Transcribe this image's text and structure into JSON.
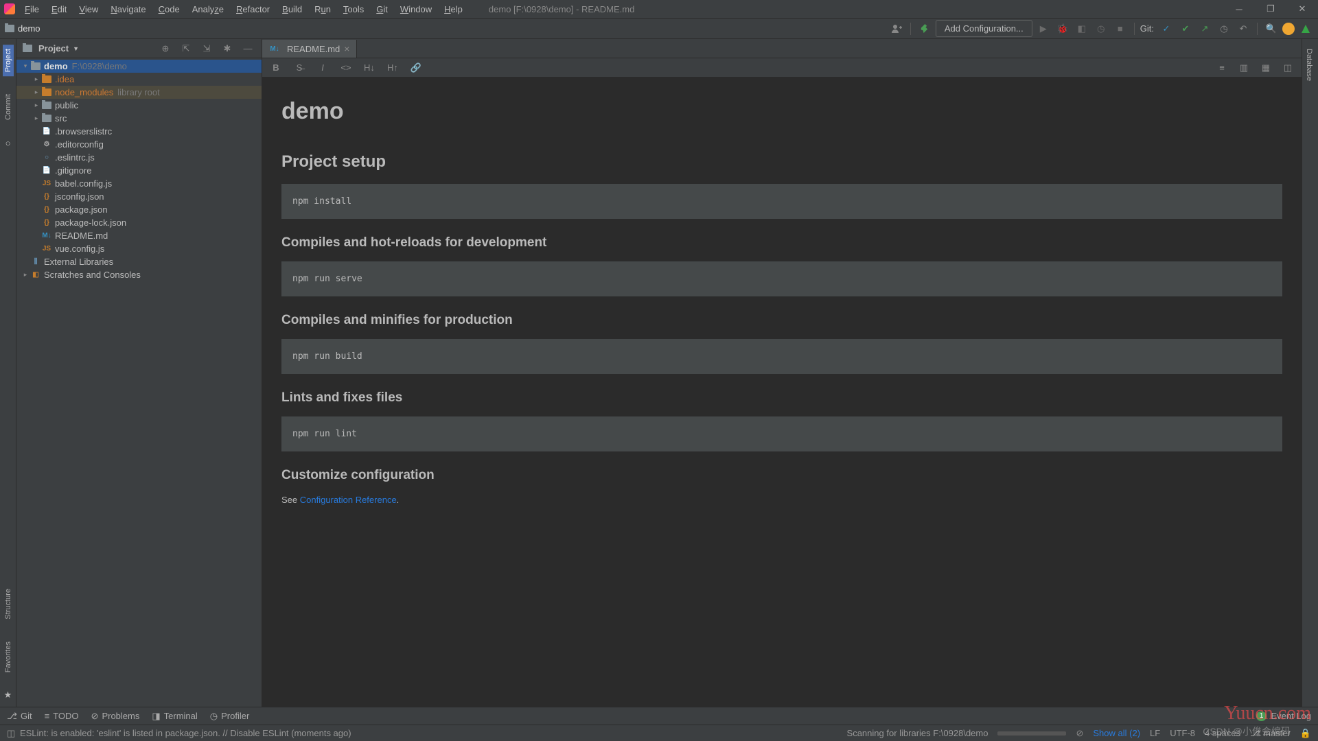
{
  "window": {
    "title": "demo [F:\\0928\\demo] - README.md"
  },
  "menu": [
    "File",
    "Edit",
    "View",
    "Navigate",
    "Code",
    "Analyze",
    "Refactor",
    "Build",
    "Run",
    "Tools",
    "Git",
    "Window",
    "Help"
  ],
  "breadcrumb": {
    "project": "demo"
  },
  "toolbar": {
    "add_config": "Add Configuration...",
    "git_label": "Git:"
  },
  "sidebar": {
    "title": "Project",
    "root": {
      "name": "demo",
      "path": "F:\\0928\\demo"
    },
    "folders": [
      {
        "name": ".idea",
        "kind": "orange"
      },
      {
        "name": "node_modules",
        "kind": "orange",
        "suffix": "library root",
        "highlight": true
      },
      {
        "name": "public",
        "kind": "gray"
      },
      {
        "name": "src",
        "kind": "gray"
      }
    ],
    "files": [
      ".browserslistrc",
      ".editorconfig",
      ".eslintrc.js",
      ".gitignore",
      "babel.config.js",
      "jsconfig.json",
      "package.json",
      "package-lock.json",
      "README.md",
      "vue.config.js"
    ],
    "extra": [
      "External Libraries",
      "Scratches and Consoles"
    ]
  },
  "tab": {
    "label": "README.md"
  },
  "md_tools": {
    "h1": "H↓",
    "h2": "H↑"
  },
  "readme": {
    "h1": "demo",
    "s1": "Project setup",
    "c1": "npm install",
    "s2": "Compiles and hot-reloads for development",
    "c2": "npm run serve",
    "s3": "Compiles and minifies for production",
    "c3": "npm run build",
    "s4": "Lints and fixes files",
    "c4": "npm run lint",
    "s5": "Customize configuration",
    "p5_pre": "See ",
    "p5_link": "Configuration Reference",
    "p5_post": "."
  },
  "left_tabs": {
    "project": "Project",
    "commit": "Commit",
    "structure": "Structure",
    "favorites": "Favorites"
  },
  "right_tabs": {
    "database": "Database"
  },
  "bottom": {
    "git": "Git",
    "todo": "TODO",
    "problems": "Problems",
    "terminal": "Terminal",
    "profiler": "Profiler",
    "event_log": "Event Log",
    "event_badge": "1"
  },
  "status": {
    "msg": "ESLint: is enabled: 'eslint' is listed in package.json. // Disable ESLint (moments ago)",
    "scanning": "Scanning for libraries F:\\0928\\demo",
    "show_all": "Show all (2)",
    "lf": "LF",
    "enc": "UTF-8",
    "indent": "4 spaces",
    "branch": "master"
  },
  "watermark": "Yuucn.com",
  "csdn": "CSDN @小俊会编码"
}
